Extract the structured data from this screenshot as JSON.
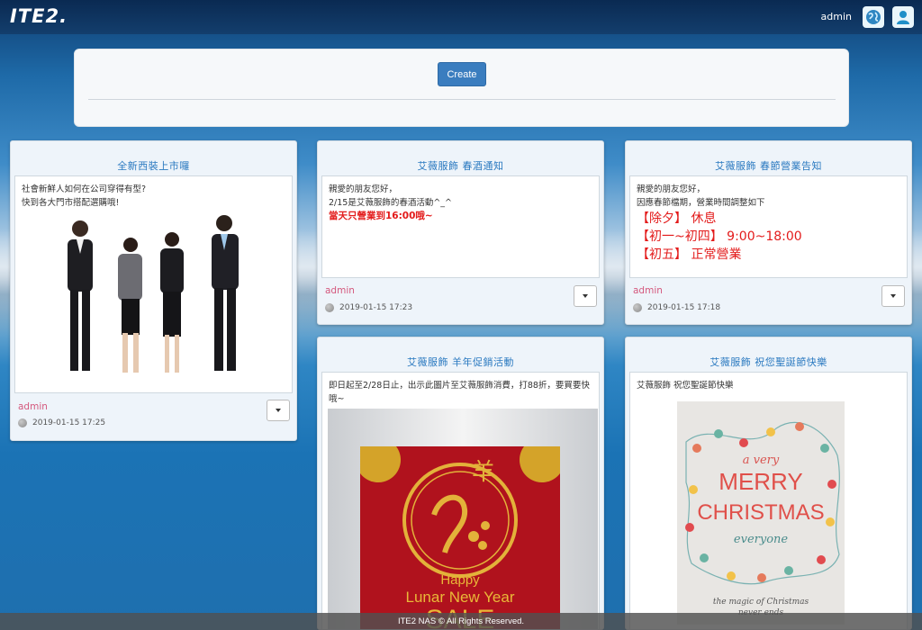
{
  "header": {
    "logo_text": "ITE2.",
    "username": "admin",
    "icons": [
      "globe-icon",
      "user-icon"
    ]
  },
  "create_panel": {
    "button_label": "Create"
  },
  "posts": [
    {
      "title": "全新西裝上市囉",
      "body": "社會新鮮人如何在公司穿得有型?\n快到各大門市搭配選購哦!",
      "image": "business-people-photo",
      "author": "admin",
      "timestamp": "2019-01-15 17:25"
    },
    {
      "title": "艾薇服飾 春酒通知",
      "body": "親愛的朋友您好，\n2/15是艾薇服飾的春酒活動^_^",
      "highlight": "當天只營業到16:00哦~",
      "author": "admin",
      "timestamp": "2019-01-15 17:23"
    },
    {
      "title": "艾薇服飾 春節營業告知",
      "body": "親愛的朋友您好，\n因應春節檔期，營業時間調整如下",
      "schedule": [
        "【除夕】 休息",
        "【初一~初四】 9:00~18:00",
        "【初五】 正常營業"
      ],
      "author": "admin",
      "timestamp": "2019-01-15 17:18"
    },
    {
      "title": "艾薇服飾 羊年促銷活動",
      "body": "即日起至2/28日止，出示此圖片至艾薇服飾消費，打88折，要買要快哦~",
      "poster": {
        "char": "羊",
        "line1": "Happy",
        "line2": "Lunar New Year",
        "line3": "SALE"
      }
    },
    {
      "title": "艾薇服飾 祝您聖誕節快樂",
      "body": "艾薇服飾 祝您聖誕節快樂",
      "card": {
        "line1": "a very",
        "line2": "MERRY",
        "line3": "CHRISTMAS",
        "line4": "everyone",
        "line5": "the magic of Christmas",
        "line6": "never ends"
      }
    }
  ],
  "footer": {
    "text": "ITE2 NAS © All Rights Reserved."
  },
  "colors": {
    "accent": "#3a7dbf",
    "title": "#2a79c0",
    "author": "#d4587d",
    "highlight": "#e31b1b"
  }
}
